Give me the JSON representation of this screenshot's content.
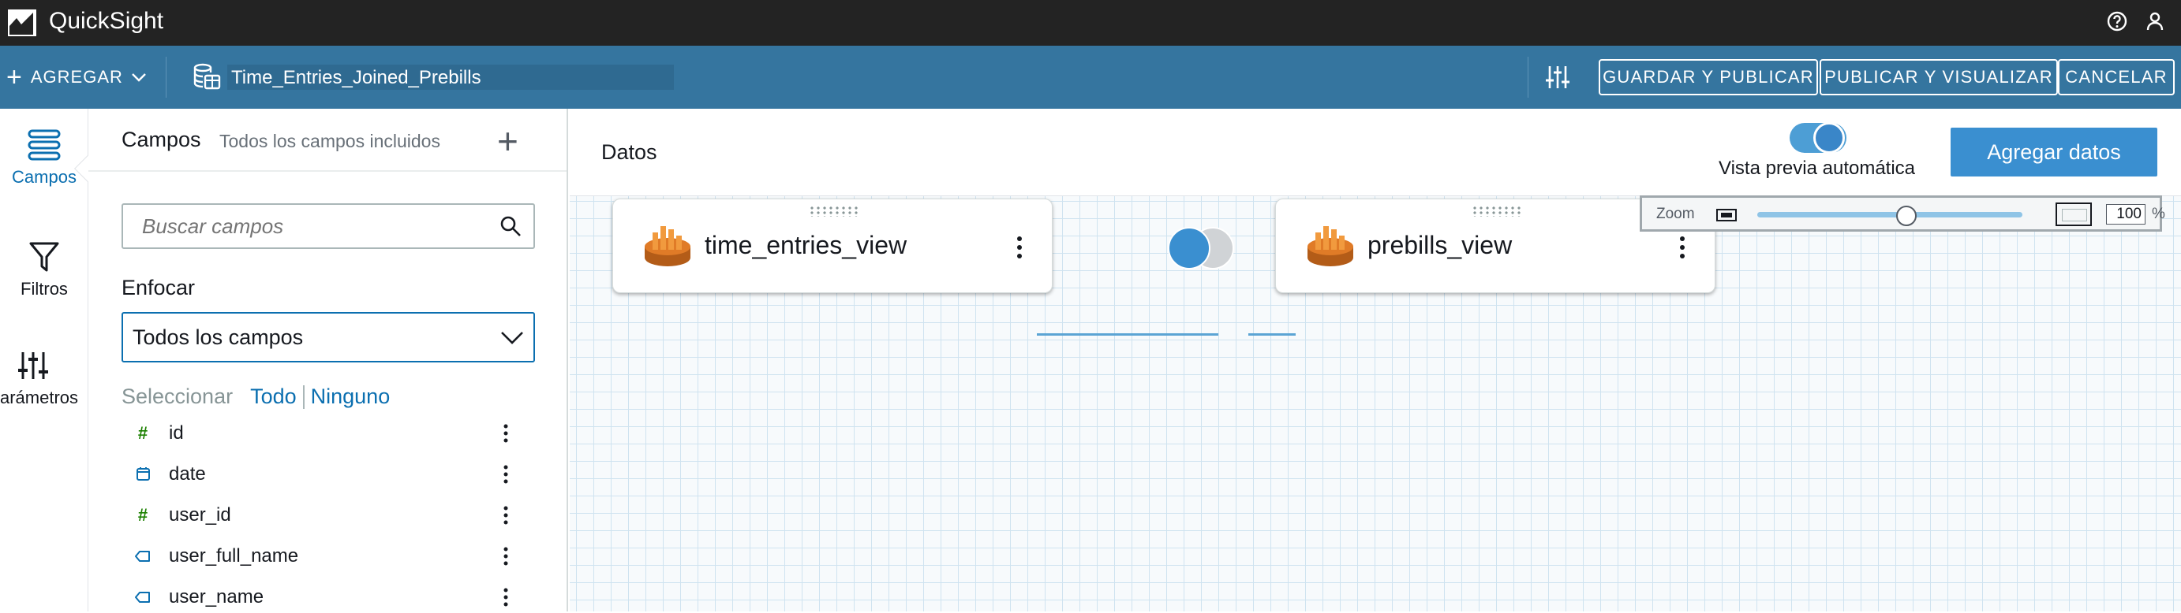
{
  "app": {
    "title": "QuickSight"
  },
  "topbar": {
    "help_icon": "help-circle-icon",
    "user_icon": "user-icon"
  },
  "toolbar": {
    "add_label": "AGREGAR",
    "dataset_name": "Time_Entries_Joined_Prebills",
    "save_publish_label": "GUARDAR Y PUBLICAR",
    "publish_visualize_label": "PUBLICAR Y VISUALIZAR",
    "cancel_label": "CANCELAR"
  },
  "rail": {
    "items": [
      {
        "label": "Campos",
        "icon": "fields-icon",
        "active": true
      },
      {
        "label": "Filtros",
        "icon": "filter-icon",
        "active": false
      },
      {
        "label": "arámetros",
        "icon": "parameters-icon",
        "active": false
      }
    ]
  },
  "fields_panel": {
    "title": "Campos",
    "subtitle": "Todos los campos incluidos",
    "search_placeholder": "Buscar campos",
    "focus_label": "Enfocar",
    "focus_value": "Todos los campos",
    "select_label": "Seleccionar",
    "select_all": "Todo",
    "select_none": "Ninguno",
    "fields": [
      {
        "name": "id",
        "type": "number"
      },
      {
        "name": "date",
        "type": "date"
      },
      {
        "name": "user_id",
        "type": "number"
      },
      {
        "name": "user_full_name",
        "type": "string"
      },
      {
        "name": "user_name",
        "type": "string"
      }
    ]
  },
  "canvas": {
    "title": "Datos",
    "auto_preview_label": "Vista previa automática",
    "auto_preview_on": true,
    "add_data_label": "Agregar datos",
    "nodes": [
      {
        "name": "time_entries_view"
      },
      {
        "name": "prebills_view"
      }
    ],
    "zoom": {
      "label": "Zoom",
      "value": "100",
      "unit": "%"
    }
  },
  "colors": {
    "topbar": "#232323",
    "toolbar": "#35759f",
    "accent": "#3a8fd0"
  }
}
